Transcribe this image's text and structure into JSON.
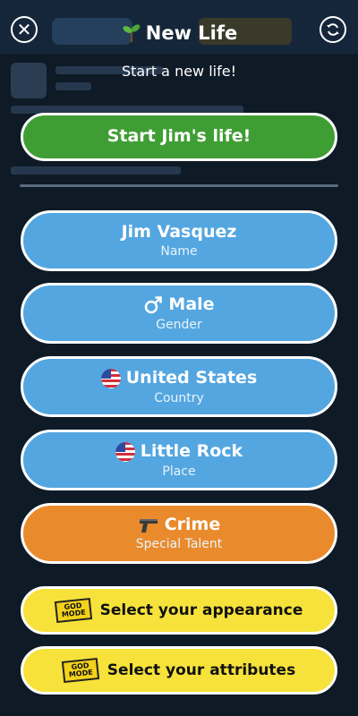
{
  "header": {
    "title": "New Life",
    "subtitle": "Start a new life!",
    "close_icon": "close-icon",
    "refresh_icon": "refresh-icon",
    "title_icon": "sprout-icon"
  },
  "start_button": {
    "label": "Start Jim's life!"
  },
  "fields": {
    "name": {
      "value": "Jim Vasquez",
      "caption": "Name"
    },
    "gender": {
      "value": "Male",
      "caption": "Gender",
      "icon": "male-symbol-icon"
    },
    "country": {
      "value": "United States",
      "caption": "Country",
      "icon": "us-flag-icon"
    },
    "place": {
      "value": "Little Rock",
      "caption": "Place",
      "icon": "us-flag-icon"
    },
    "talent": {
      "value": "Crime",
      "caption": "Special Talent",
      "icon": "pistol-icon"
    }
  },
  "god_mode": {
    "badge_text": "GOD MODE",
    "appearance_label": "Select your appearance",
    "attributes_label": "Select your attributes"
  },
  "colors": {
    "start": "#3f9e33",
    "field": "#53a6e0",
    "talent": "#e98a2c",
    "god_mode": "#f6e23a"
  }
}
